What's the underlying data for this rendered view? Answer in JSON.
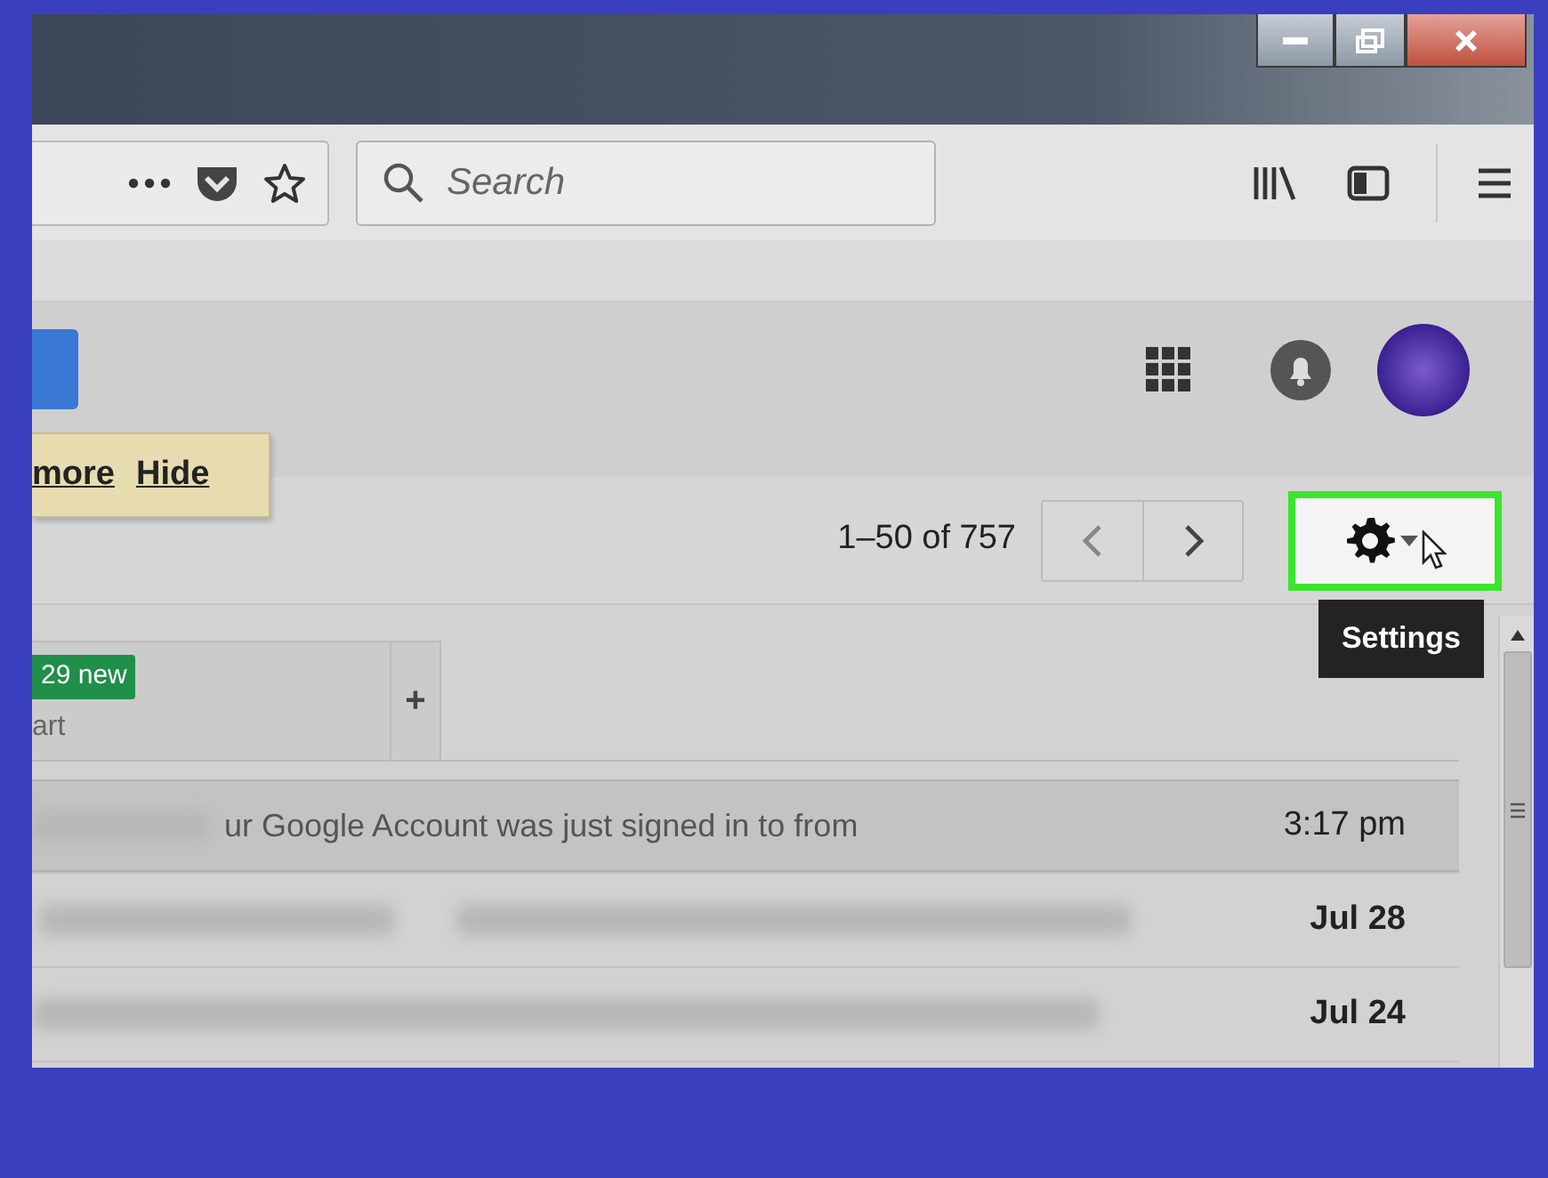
{
  "browser": {
    "search": {
      "placeholder": "Search"
    }
  },
  "notice": {
    "links": [
      "more",
      "Hide"
    ]
  },
  "pagination": {
    "range": "1–50 of 757"
  },
  "settings": {
    "tooltip": "Settings",
    "highlighted": true
  },
  "tabs": [
    {
      "badge": "29 new",
      "label": "art"
    }
  ],
  "add_tab": "+",
  "emails": [
    {
      "snippet": "ur Google Account was just signed in to from",
      "time": "3:17 pm",
      "unread": false,
      "selected": true
    },
    {
      "time": "Jul 28",
      "unread": true,
      "selected": false
    },
    {
      "time": "Jul 24",
      "unread": true,
      "selected": false
    }
  ]
}
